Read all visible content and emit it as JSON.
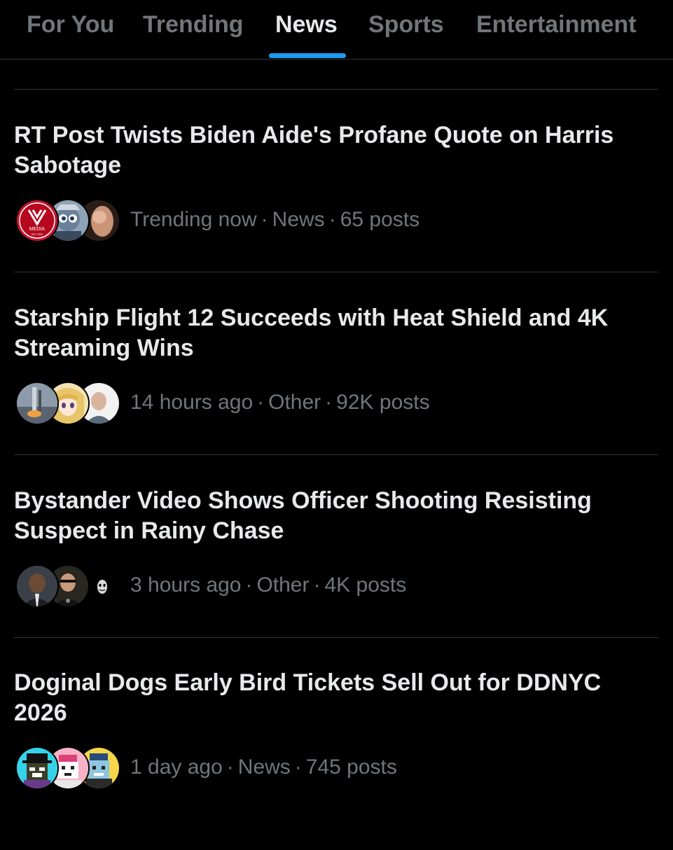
{
  "tabs": [
    {
      "label": "For You"
    },
    {
      "label": "Trending"
    },
    {
      "label": "News",
      "active": true
    },
    {
      "label": "Sports"
    },
    {
      "label": "Entertainment"
    }
  ],
  "accent_color": "#1d9bf0",
  "stories": [
    {
      "headline": "RT Post Twists Biden Aide's Profane Quote on Harris Sabotage",
      "time": "Trending now",
      "category": "News",
      "posts": "65 posts",
      "avatars": [
        {
          "icon": "media-logo-avatar",
          "logo_text": "MEDIA",
          "logo_subtext": "EST. 2023"
        },
        {
          "icon": "cartoon-character-avatar"
        },
        {
          "icon": "person-photo-avatar"
        }
      ]
    },
    {
      "headline": "Starship Flight 12 Succeeds with Heat Shield and 4K Streaming Wins",
      "time": "14 hours ago",
      "category": "Other",
      "posts": "92K posts",
      "avatars": [
        {
          "icon": "rocket-launch-avatar"
        },
        {
          "icon": "anime-character-avatar"
        },
        {
          "icon": "person-photo-avatar"
        }
      ]
    },
    {
      "headline": "Bystander Video Shows Officer Shooting Resisting Suspect in Rainy Chase",
      "time": "3 hours ago",
      "category": "Other",
      "posts": "4K posts",
      "avatars": [
        {
          "icon": "person-photo-avatar"
        },
        {
          "icon": "person-photo-avatar"
        },
        {
          "icon": "ghost-face-avatar"
        }
      ]
    },
    {
      "headline": "Doginal Dogs Early Bird Tickets Sell Out for DDNYC 2026",
      "time": "1 day ago",
      "category": "News",
      "posts": "745 posts",
      "avatars": [
        {
          "icon": "pixel-dog-avatar"
        },
        {
          "icon": "pixel-dog-avatar"
        },
        {
          "icon": "pixel-dog-avatar"
        }
      ]
    }
  ]
}
